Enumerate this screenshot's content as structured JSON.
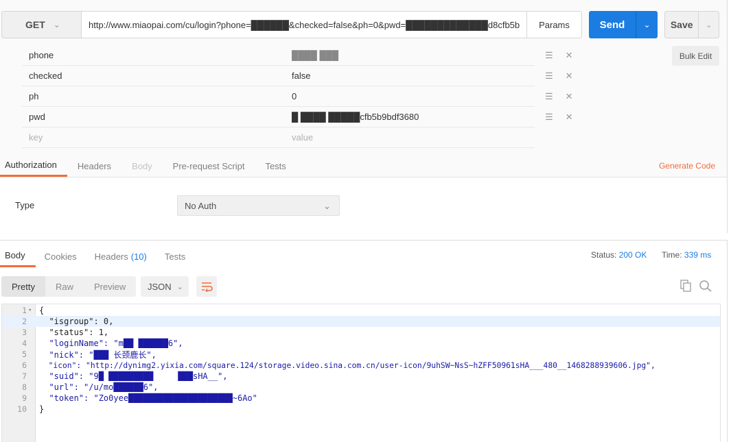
{
  "request": {
    "method": "GET",
    "url": "http://www.miaopai.com/cu/login?phone=██████&checked=false&ph=0&pwd=█████████████d8cfb5b",
    "params_label": "Params",
    "send_label": "Send",
    "save_label": "Save",
    "bulk_edit_label": "Bulk Edit",
    "params": [
      {
        "key": "phone",
        "value": "████ ███"
      },
      {
        "key": "checked",
        "value": "false"
      },
      {
        "key": "ph",
        "value": "0"
      },
      {
        "key": "pwd",
        "value": "█ ████   █████cfb5b9bdf3680"
      }
    ],
    "placeholder_key": "key",
    "placeholder_value": "value",
    "tabs": [
      "Authorization",
      "Headers",
      "Body",
      "Pre-request Script",
      "Tests"
    ],
    "generate_code_label": "Generate Code",
    "auth_type_label": "Type",
    "auth_type_value": "No Auth"
  },
  "response": {
    "tabs": {
      "body": "Body",
      "cookies": "Cookies",
      "headers": "Headers",
      "headers_count": "(10)",
      "tests": "Tests"
    },
    "status_label": "Status:",
    "status_value": "200 OK",
    "time_label": "Time:",
    "time_value": "339 ms",
    "format_buttons": [
      "Pretty",
      "Raw",
      "Preview"
    ],
    "format_select": "JSON",
    "lines": [
      {
        "n": "1",
        "code": "{"
      },
      {
        "n": "2",
        "code": "  \"isgroup\": 0,"
      },
      {
        "n": "3",
        "code": "  \"status\": 1,"
      },
      {
        "n": "4",
        "code": "  \"loginName\": \"m██ ██████6\","
      },
      {
        "n": "5",
        "code": "  \"nick\": \"███ 长颈鹿长\","
      },
      {
        "n": "6",
        "code": "  \"icon\": \"http://dynimg2.yixia.com/square.124/storage.video.sina.com.cn/user-icon/9uhSW~NsS~hZFF50961sHA___480__1468288939606.jpg\","
      },
      {
        "n": "7",
        "code": "  \"suid\": \"9█ █████████     ███sHA__\","
      },
      {
        "n": "8",
        "code": "  \"url\": \"/u/mo██████6\","
      },
      {
        "n": "9",
        "code": "  \"token\": \"Zo0yee█████████████████████~6Ao\""
      },
      {
        "n": "10",
        "code": "}"
      }
    ]
  },
  "colors": {
    "accent": "#f26b3a",
    "send": "#1b7de1",
    "link": "#1b7de1"
  }
}
